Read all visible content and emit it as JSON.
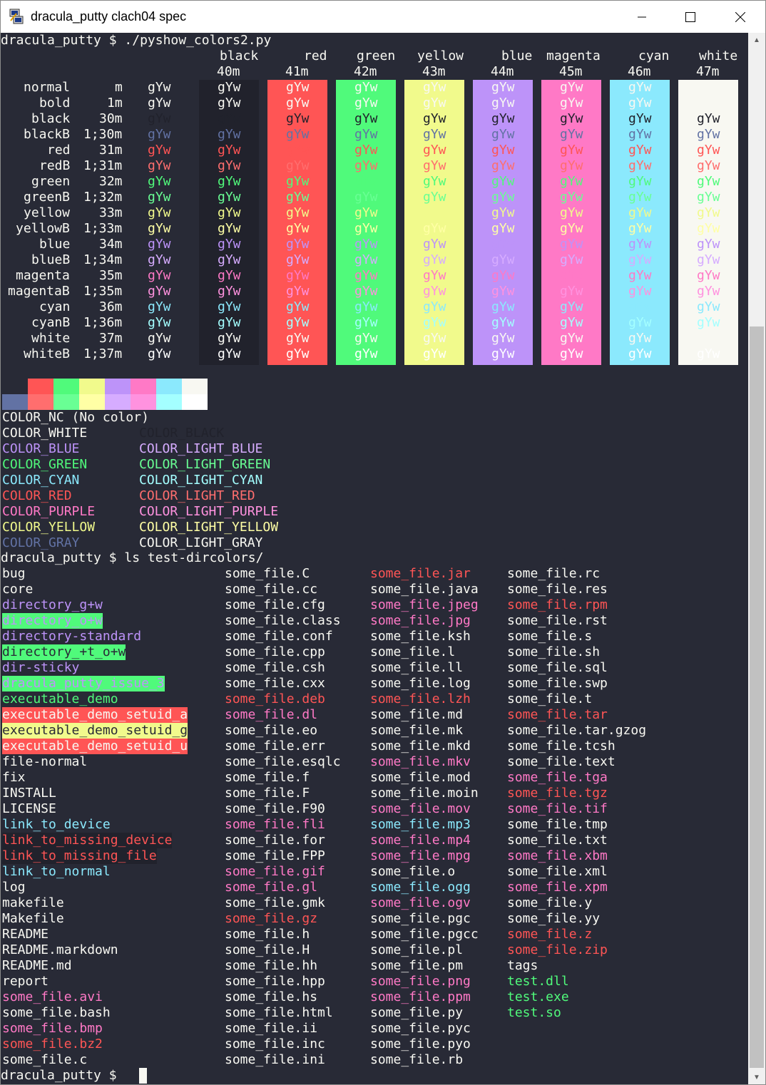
{
  "window": {
    "title": "dracula_putty clach04 spec",
    "minimize_icon": "minimize-icon",
    "maximize_icon": "maximize-icon",
    "close_icon": "close-icon"
  },
  "colors": {
    "bg": "#282a36",
    "fg": "#f8f8f2",
    "black": "#21222c",
    "blackB": "#6272a4",
    "red": "#ff5555",
    "green": "#50fa7b",
    "yellow": "#f1fa8c",
    "blue": "#bd93f9",
    "magenta": "#ff79c6",
    "cyan": "#8be9fd",
    "white": "#f8f8f2",
    "redB": "#ff6e6e",
    "greenB": "#69ff94",
    "yellowB": "#ffffa5",
    "blueB": "#d6acff",
    "magentaB": "#ff92df",
    "cyanB": "#a4ffff",
    "whiteB": "#ffffff"
  },
  "terminal": {
    "cmd1": "dracula_putty $ ./pyshow_colors2.py",
    "bg_names": [
      "black",
      "red",
      "green",
      "yellow",
      "blue",
      "magenta",
      "cyan",
      "white"
    ],
    "bg_codes": [
      "40m",
      "41m",
      "42m",
      "43m",
      "44m",
      "45m",
      "46m",
      "47m"
    ],
    "sample": "gYw",
    "rows": [
      {
        "name": "normal",
        "code": "m"
      },
      {
        "name": "bold",
        "code": "1m"
      },
      {
        "name": "black",
        "code": "30m"
      },
      {
        "name": "blackB",
        "code": "1;30m"
      },
      {
        "name": "red",
        "code": "31m"
      },
      {
        "name": "redB",
        "code": "1;31m"
      },
      {
        "name": "green",
        "code": "32m"
      },
      {
        "name": "greenB",
        "code": "1;32m"
      },
      {
        "name": "yellow",
        "code": "33m"
      },
      {
        "name": "yellowB",
        "code": "1;33m"
      },
      {
        "name": "blue",
        "code": "34m"
      },
      {
        "name": "blueB",
        "code": "1;34m"
      },
      {
        "name": "magenta",
        "code": "35m"
      },
      {
        "name": "magentaB",
        "code": "1;35m"
      },
      {
        "name": "cyan",
        "code": "36m"
      },
      {
        "name": "cyanB",
        "code": "1;36m"
      },
      {
        "name": "white",
        "code": "37m"
      },
      {
        "name": "whiteB",
        "code": "1;37m"
      }
    ],
    "swatches_top": [
      "#282a36",
      "#ff5555",
      "#50fa7b",
      "#f1fa8c",
      "#bd93f9",
      "#ff79c6",
      "#8be9fd",
      "#f8f8f2"
    ],
    "swatches_bottom": [
      "#6272a4",
      "#ff6e6e",
      "#69ff94",
      "#ffffa5",
      "#d6acff",
      "#ff92df",
      "#a4ffff",
      "#ffffff"
    ],
    "color_lines": [
      {
        "left": "COLOR_NC (No color)",
        "left_color": "#f8f8f2",
        "right": "",
        "right_color": "#f8f8f2"
      },
      {
        "left": "COLOR_WHITE",
        "left_color": "#f8f8f2",
        "right": "COLOR_BLACK",
        "right_color": "#21222c"
      },
      {
        "left": "COLOR_BLUE",
        "left_color": "#bd93f9",
        "right": "COLOR_LIGHT_BLUE",
        "right_color": "#d6acff"
      },
      {
        "left": "COLOR_GREEN",
        "left_color": "#50fa7b",
        "right": "COLOR_LIGHT_GREEN",
        "right_color": "#69ff94"
      },
      {
        "left": "COLOR_CYAN",
        "left_color": "#8be9fd",
        "right": "COLOR_LIGHT_CYAN",
        "right_color": "#a4ffff"
      },
      {
        "left": "COLOR_RED",
        "left_color": "#ff5555",
        "right": "COLOR_LIGHT_RED",
        "right_color": "#ff6e6e"
      },
      {
        "left": "COLOR_PURPLE",
        "left_color": "#ff79c6",
        "right": "COLOR_LIGHT_PURPLE",
        "right_color": "#ff92df"
      },
      {
        "left": "COLOR_YELLOW",
        "left_color": "#f1fa8c",
        "right": "COLOR_LIGHT_YELLOW",
        "right_color": "#ffffa5"
      },
      {
        "left": "COLOR_GRAY",
        "left_color": "#6272a4",
        "right": "COLOR_LIGHT_GRAY",
        "right_color": "#f8f8f2"
      }
    ],
    "cmd2": "dracula_putty $ ls test-dircolors/",
    "ls_columns": [
      [
        {
          "t": "bug",
          "c": "#f8f8f2"
        },
        {
          "t": "core",
          "c": "#f8f8f2"
        },
        {
          "t": "directory_g+w",
          "c": "#bd93f9"
        },
        {
          "t": "directory_o+w",
          "c": "#bd93f9",
          "bg": "#50fa7b"
        },
        {
          "t": "directory-standard",
          "c": "#bd93f9"
        },
        {
          "t": "directory_+t_o+w",
          "c": "#282a36",
          "bg": "#50fa7b"
        },
        {
          "t": "dir-sticky",
          "c": "#bd93f9"
        },
        {
          "t": "dracula_putty_issue_3",
          "c": "#bd93f9",
          "bg": "#50fa7b"
        },
        {
          "t": "executable_demo",
          "c": "#50fa7b"
        },
        {
          "t": "executable_demo_setuid_a",
          "c": "#f8f8f2",
          "bg": "#ff5555"
        },
        {
          "t": "executable_demo_setuid_g",
          "c": "#282a36",
          "bg": "#f1fa8c"
        },
        {
          "t": "executable_demo_setuid_u",
          "c": "#f8f8f2",
          "bg": "#ff5555"
        },
        {
          "t": "file-normal",
          "c": "#f8f8f2"
        },
        {
          "t": "fix",
          "c": "#f8f8f2"
        },
        {
          "t": "INSTALL",
          "c": "#f8f8f2"
        },
        {
          "t": "LICENSE",
          "c": "#f8f8f2"
        },
        {
          "t": "link_to_device",
          "c": "#8be9fd"
        },
        {
          "t": "link_to_missing_device",
          "c": "#ff5555",
          "bg": "#21222c"
        },
        {
          "t": "link_to_missing_file",
          "c": "#ff5555",
          "bg": "#21222c"
        },
        {
          "t": "link_to_normal",
          "c": "#8be9fd"
        },
        {
          "t": "log",
          "c": "#f8f8f2"
        },
        {
          "t": "makefile",
          "c": "#f8f8f2"
        },
        {
          "t": "Makefile",
          "c": "#f8f8f2"
        },
        {
          "t": "README",
          "c": "#f8f8f2"
        },
        {
          "t": "README.markdown",
          "c": "#f8f8f2"
        },
        {
          "t": "README.md",
          "c": "#f8f8f2"
        },
        {
          "t": "report",
          "c": "#f8f8f2"
        },
        {
          "t": "some_file.avi",
          "c": "#ff79c6"
        },
        {
          "t": "some_file.bash",
          "c": "#f8f8f2"
        },
        {
          "t": "some_file.bmp",
          "c": "#ff79c6"
        },
        {
          "t": "some_file.bz2",
          "c": "#ff5555"
        },
        {
          "t": "some_file.c",
          "c": "#f8f8f2"
        }
      ],
      [
        {
          "t": "some_file.C",
          "c": "#f8f8f2"
        },
        {
          "t": "some_file.cc",
          "c": "#f8f8f2"
        },
        {
          "t": "some_file.cfg",
          "c": "#f8f8f2"
        },
        {
          "t": "some_file.class",
          "c": "#f8f8f2"
        },
        {
          "t": "some_file.conf",
          "c": "#f8f8f2"
        },
        {
          "t": "some_file.cpp",
          "c": "#f8f8f2"
        },
        {
          "t": "some_file.csh",
          "c": "#f8f8f2"
        },
        {
          "t": "some_file.cxx",
          "c": "#f8f8f2"
        },
        {
          "t": "some_file.deb",
          "c": "#ff5555"
        },
        {
          "t": "some_file.dl",
          "c": "#ff79c6"
        },
        {
          "t": "some_file.eo",
          "c": "#f8f8f2"
        },
        {
          "t": "some_file.err",
          "c": "#f8f8f2"
        },
        {
          "t": "some_file.esqlc",
          "c": "#f8f8f2"
        },
        {
          "t": "some_file.f",
          "c": "#f8f8f2"
        },
        {
          "t": "some_file.F",
          "c": "#f8f8f2"
        },
        {
          "t": "some_file.F90",
          "c": "#f8f8f2"
        },
        {
          "t": "some_file.fli",
          "c": "#ff79c6"
        },
        {
          "t": "some_file.for",
          "c": "#f8f8f2"
        },
        {
          "t": "some_file.FPP",
          "c": "#f8f8f2"
        },
        {
          "t": "some_file.gif",
          "c": "#ff79c6"
        },
        {
          "t": "some_file.gl",
          "c": "#ff79c6"
        },
        {
          "t": "some_file.gmk",
          "c": "#f8f8f2"
        },
        {
          "t": "some_file.gz",
          "c": "#ff5555"
        },
        {
          "t": "some_file.h",
          "c": "#f8f8f2"
        },
        {
          "t": "some_file.H",
          "c": "#f8f8f2"
        },
        {
          "t": "some_file.hh",
          "c": "#f8f8f2"
        },
        {
          "t": "some_file.hpp",
          "c": "#f8f8f2"
        },
        {
          "t": "some_file.hs",
          "c": "#f8f8f2"
        },
        {
          "t": "some_file.html",
          "c": "#f8f8f2"
        },
        {
          "t": "some_file.ii",
          "c": "#f8f8f2"
        },
        {
          "t": "some_file.inc",
          "c": "#f8f8f2"
        },
        {
          "t": "some_file.ini",
          "c": "#f8f8f2"
        }
      ],
      [
        {
          "t": "some_file.jar",
          "c": "#ff5555"
        },
        {
          "t": "some_file.java",
          "c": "#f8f8f2"
        },
        {
          "t": "some_file.jpeg",
          "c": "#ff79c6"
        },
        {
          "t": "some_file.jpg",
          "c": "#ff79c6"
        },
        {
          "t": "some_file.ksh",
          "c": "#f8f8f2"
        },
        {
          "t": "some_file.l",
          "c": "#f8f8f2"
        },
        {
          "t": "some_file.ll",
          "c": "#f8f8f2"
        },
        {
          "t": "some_file.log",
          "c": "#f8f8f2"
        },
        {
          "t": "some_file.lzh",
          "c": "#ff5555"
        },
        {
          "t": "some_file.md",
          "c": "#f8f8f2"
        },
        {
          "t": "some_file.mk",
          "c": "#f8f8f2"
        },
        {
          "t": "some_file.mkd",
          "c": "#f8f8f2"
        },
        {
          "t": "some_file.mkv",
          "c": "#ff79c6"
        },
        {
          "t": "some_file.mod",
          "c": "#f8f8f2"
        },
        {
          "t": "some_file.moin",
          "c": "#f8f8f2"
        },
        {
          "t": "some_file.mov",
          "c": "#ff79c6"
        },
        {
          "t": "some_file.mp3",
          "c": "#8be9fd"
        },
        {
          "t": "some_file.mp4",
          "c": "#ff79c6"
        },
        {
          "t": "some_file.mpg",
          "c": "#ff79c6"
        },
        {
          "t": "some_file.o",
          "c": "#f8f8f2"
        },
        {
          "t": "some_file.ogg",
          "c": "#8be9fd"
        },
        {
          "t": "some_file.ogv",
          "c": "#ff79c6"
        },
        {
          "t": "some_file.pgc",
          "c": "#f8f8f2"
        },
        {
          "t": "some_file.pgcc",
          "c": "#f8f8f2"
        },
        {
          "t": "some_file.pl",
          "c": "#f8f8f2"
        },
        {
          "t": "some_file.pm",
          "c": "#f8f8f2"
        },
        {
          "t": "some_file.png",
          "c": "#ff79c6"
        },
        {
          "t": "some_file.ppm",
          "c": "#ff79c6"
        },
        {
          "t": "some_file.py",
          "c": "#f8f8f2"
        },
        {
          "t": "some_file.pyc",
          "c": "#f8f8f2"
        },
        {
          "t": "some_file.pyo",
          "c": "#f8f8f2"
        },
        {
          "t": "some_file.rb",
          "c": "#f8f8f2"
        }
      ],
      [
        {
          "t": "some_file.rc",
          "c": "#f8f8f2"
        },
        {
          "t": "some_file.res",
          "c": "#f8f8f2"
        },
        {
          "t": "some_file.rpm",
          "c": "#ff5555"
        },
        {
          "t": "some_file.rst",
          "c": "#f8f8f2"
        },
        {
          "t": "some_file.s",
          "c": "#f8f8f2"
        },
        {
          "t": "some_file.sh",
          "c": "#f8f8f2"
        },
        {
          "t": "some_file.sql",
          "c": "#f8f8f2"
        },
        {
          "t": "some_file.swp",
          "c": "#f8f8f2"
        },
        {
          "t": "some_file.t",
          "c": "#f8f8f2"
        },
        {
          "t": "some_file.tar",
          "c": "#ff5555"
        },
        {
          "t": "some_file.tar.gzog",
          "c": "#f8f8f2"
        },
        {
          "t": "some_file.tcsh",
          "c": "#f8f8f2"
        },
        {
          "t": "some_file.text",
          "c": "#f8f8f2"
        },
        {
          "t": "some_file.tga",
          "c": "#ff79c6"
        },
        {
          "t": "some_file.tgz",
          "c": "#ff5555"
        },
        {
          "t": "some_file.tif",
          "c": "#ff79c6"
        },
        {
          "t": "some_file.tmp",
          "c": "#f8f8f2"
        },
        {
          "t": "some_file.txt",
          "c": "#f8f8f2"
        },
        {
          "t": "some_file.xbm",
          "c": "#ff79c6"
        },
        {
          "t": "some_file.xml",
          "c": "#f8f8f2"
        },
        {
          "t": "some_file.xpm",
          "c": "#ff79c6"
        },
        {
          "t": "some_file.y",
          "c": "#f8f8f2"
        },
        {
          "t": "some_file.yy",
          "c": "#f8f8f2"
        },
        {
          "t": "some_file.z",
          "c": "#ff5555"
        },
        {
          "t": "some_file.zip",
          "c": "#ff5555"
        },
        {
          "t": "tags",
          "c": "#f8f8f2"
        },
        {
          "t": "test.dll",
          "c": "#50fa7b"
        },
        {
          "t": "test.exe",
          "c": "#50fa7b"
        },
        {
          "t": "test.so",
          "c": "#50fa7b"
        }
      ]
    ],
    "prompt": "dracula_putty $ "
  }
}
